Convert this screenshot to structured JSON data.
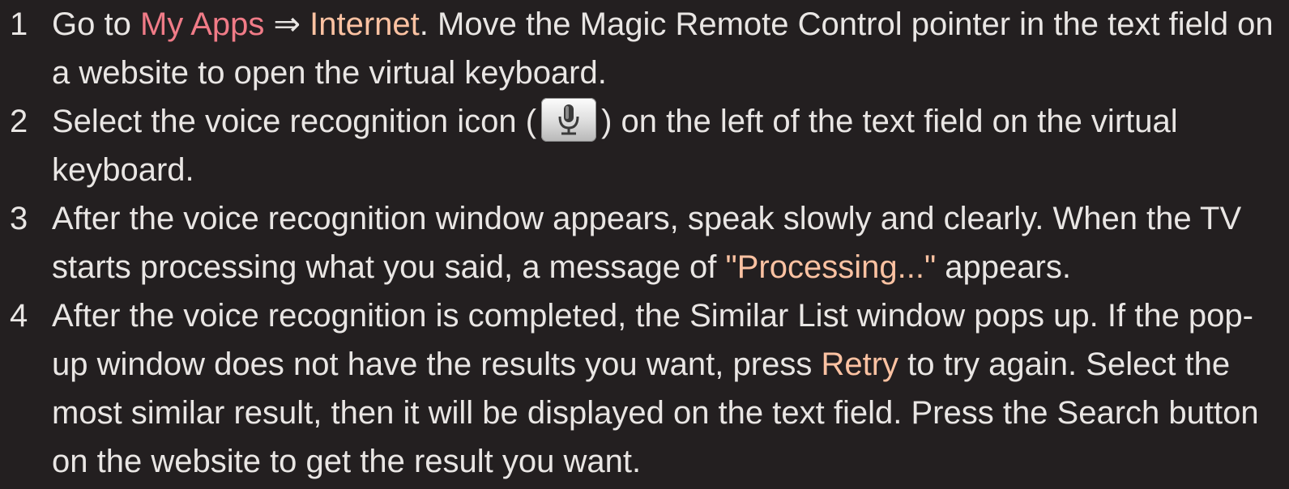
{
  "steps": [
    {
      "number": "1",
      "text_a": "Go to",
      "link_my_apps": "My Apps",
      "arrow": "⇒",
      "link_internet": "Internet",
      "text_b": ". Move the Magic Remote Control pointer in the text field on a website to open the virtual keyboard."
    },
    {
      "number": "2",
      "text_a": "Select the voice recognition icon (",
      "icon": "microphone-icon",
      "text_b": ") on the left of the text field on the virtual keyboard."
    },
    {
      "number": "3",
      "text_a": "After the voice recognition window appears, speak slowly and clearly. When the TV starts processing what you said, a message of",
      "highlight": "\"Processing...\"",
      "text_b": "appears."
    },
    {
      "number": "4",
      "text_a": "After the voice recognition is completed, the Similar List window pops up. If the pop-up window does not have the results you want, press",
      "highlight": "Retry",
      "text_b": "to try again. Select the most similar result, then it will be displayed on the text field. Press the Search button on the website to get the result you want."
    }
  ],
  "colors": {
    "background": "#231f20",
    "text": "#e9e6e4",
    "accent_pink": "#f07b87",
    "accent_peach": "#fcc2a2"
  }
}
